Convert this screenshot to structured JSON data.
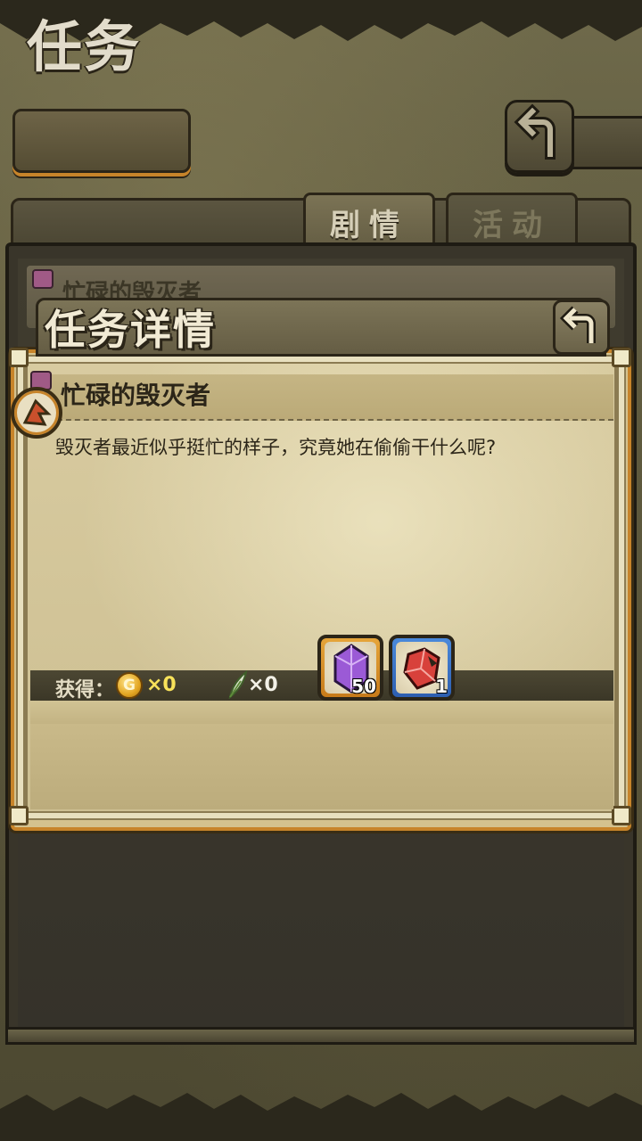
{
  "header": {
    "title": "任务"
  },
  "tabs": [
    {
      "label": "剧情",
      "active": true
    },
    {
      "label": "活动",
      "active": false
    }
  ],
  "list": {
    "items": [
      {
        "title": "忙碌的毁灭者"
      }
    ]
  },
  "dialog": {
    "title": "任务详情",
    "quest_title": "忙碌的毁灭者",
    "description": "毁灭者最近似乎挺忙的样子，究竟她在偷偷干什么呢?",
    "reward_label": "获得：",
    "coin_symbol": "G",
    "coin_count": "×0",
    "feather_count": "×0",
    "items": [
      {
        "name": "purple-crystal",
        "count": "50",
        "frame_color": "#e6a53a"
      },
      {
        "name": "red-gem-shard",
        "count": "1",
        "frame_color": "#4a89db"
      }
    ]
  },
  "colors": {
    "accent_orange": "#c7842a",
    "parchment": "#d4c28e",
    "dark_frame": "#2b2518"
  }
}
